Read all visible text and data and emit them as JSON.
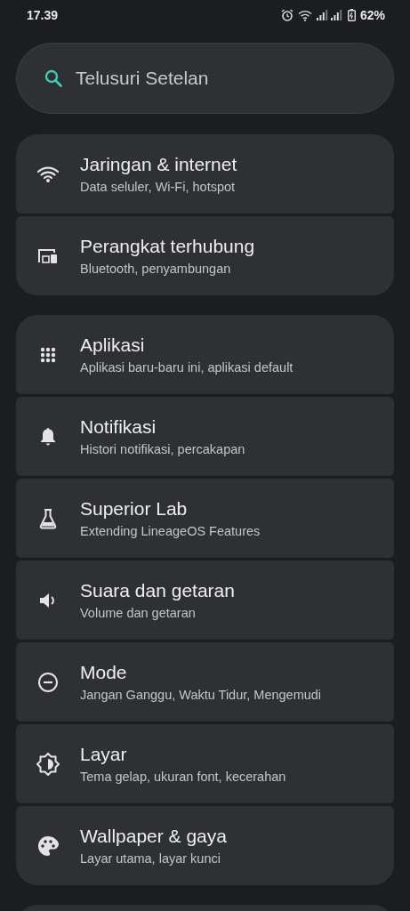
{
  "status_bar": {
    "time": "17.39",
    "battery": "62%"
  },
  "search": {
    "placeholder": "Telusuri Setelan"
  },
  "groups": [
    {
      "items": [
        {
          "kind": "wifi",
          "title": "Jaringan & internet",
          "subtitle": "Data seluler, Wi-Fi, hotspot"
        },
        {
          "kind": "devices",
          "title": "Perangkat terhubung",
          "subtitle": "Bluetooth, penyambungan"
        }
      ]
    },
    {
      "items": [
        {
          "kind": "apps",
          "title": "Aplikasi",
          "subtitle": "Aplikasi baru-baru ini, aplikasi default"
        },
        {
          "kind": "bell",
          "title": "Notifikasi",
          "subtitle": "Histori notifikasi, percakapan"
        },
        {
          "kind": "flask",
          "title": "Superior Lab",
          "subtitle": "Extending LineageOS Features"
        },
        {
          "kind": "speaker",
          "title": "Suara dan getaran",
          "subtitle": "Volume dan getaran"
        },
        {
          "kind": "mode",
          "title": "Mode",
          "subtitle": "Jangan Ganggu, Waktu Tidur, Mengemudi"
        },
        {
          "kind": "display",
          "title": "Layar",
          "subtitle": "Tema gelap, ukuran font, kecerahan"
        },
        {
          "kind": "palette",
          "title": "Wallpaper & gaya",
          "subtitle": "Layar utama, layar kunci"
        }
      ]
    }
  ]
}
